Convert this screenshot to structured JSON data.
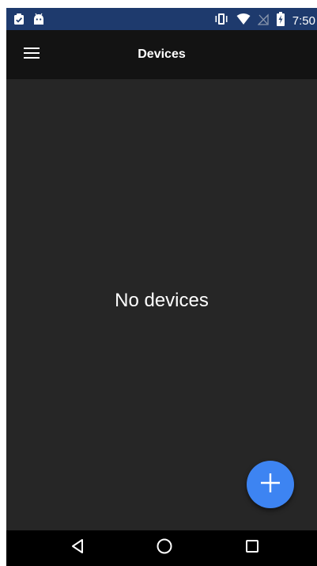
{
  "status_bar": {
    "time": "7:50",
    "left_icons": [
      "clipboard-check-icon",
      "android-icon"
    ],
    "right_icons": [
      "vibrate-icon",
      "wifi-icon",
      "no-signal-icon",
      "battery-charging-icon"
    ],
    "background": "#1e3a6d"
  },
  "app_bar": {
    "title": "Devices",
    "menu_icon": "hamburger-menu-icon"
  },
  "main": {
    "empty_message": "No devices"
  },
  "fab": {
    "icon": "plus-icon",
    "color": "#3d84f2"
  },
  "nav_bar": {
    "buttons": [
      "back-icon",
      "home-icon",
      "recents-icon"
    ]
  }
}
